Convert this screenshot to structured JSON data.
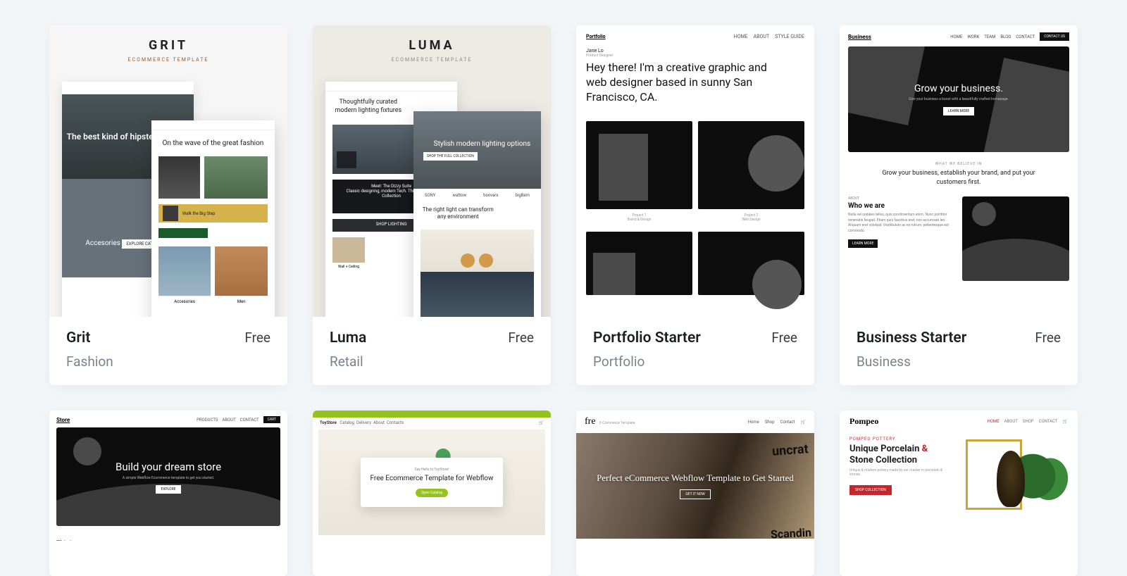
{
  "templates": [
    {
      "name": "Grit",
      "price": "Free",
      "category": "Fashion"
    },
    {
      "name": "Luma",
      "price": "Free",
      "category": "Retail"
    },
    {
      "name": "Portfolio Starter",
      "price": "Free",
      "category": "Portfolio"
    },
    {
      "name": "Business Starter",
      "price": "Free",
      "category": "Business"
    }
  ],
  "grit": {
    "title": "GRIT",
    "subtitle": "ECOMMERCE TEMPLATE",
    "hero": "The best kind of hipster clothing",
    "wave": "On the wave of the great fashion",
    "strip": "Walk the Big Step",
    "acc_title": "Accesories",
    "card_a": "Accesories",
    "card_b": "Men"
  },
  "luma": {
    "title": "LUMA",
    "subtitle": "ECOMMERCE TEMPLATE",
    "txt": "Thoughtfully curated modern lighting fixtures",
    "hero": "Stylish modern lighting options",
    "herobtn": "SHOP THE FULL COLLECTION",
    "cats": [
      "SONY",
      "wattow",
      "bonvars",
      "bigBem"
    ],
    "txt2": "The right light can transform any environment",
    "small": "Wall + Ceiling"
  },
  "portfolio": {
    "brand": "Portfolio",
    "nav": [
      "HOME",
      "ABOUT",
      "STYLE GUIDE"
    ],
    "name": "Jane Lo",
    "role": "Product Designer",
    "headline": "Hey there! I'm a creative graphic and web designer based in sunny San Francisco, CA.",
    "p1": "Project 1",
    "p1s": "Brand & Design",
    "p2": "Project 2",
    "p2s": "Web Design"
  },
  "business": {
    "brand": "Business",
    "nav": [
      "HOME",
      "WORK",
      "TEAM",
      "BLOG",
      "CONTACT"
    ],
    "cta": "CONTACT US",
    "hero": "Grow your business.",
    "herosub": "Give your business a boost with a beautifully crafted homepage.",
    "herobtn": "LEARN MORE",
    "midlbl": "WHAT WE BELIEVE IN",
    "midtxt": "Grow your business, establish your brand, and put your customers first.",
    "aboutlbl": "ABOUT",
    "about": "Who we are",
    "aboutp": "Nulla vel sodales tellus, quis condimentum enim. Nunc porttitor venenatis feugiat. Etiam quis faucibus erat, non accumsan leo. Aliquam erat volutpat. Vestibulum ac ex rutrum, pellentesque est commodo.",
    "aboutbtn": "LEARN MORE"
  },
  "row2": {
    "store": {
      "brand": "Store",
      "nav": [
        "PRODUCTS",
        "ABOUT",
        "CONTACT"
      ],
      "cart": "CART",
      "hero": "Build your dream store",
      "herosub": "A simple Webflow Ecommerce template to get you started.",
      "herobtn": "EXPLORE",
      "head": "This is your space"
    },
    "toystore": {
      "brand": "ToyStore",
      "nav": [
        "Catalog",
        "Delivery",
        "About",
        "Contacts"
      ],
      "cardlbl": "Say Hello to ToyStore!",
      "cardtitle": "Free Ecommerce Template for Webflow",
      "cardbtn": "Open Catalog"
    },
    "fre": {
      "brand": "fre",
      "sub": "E-Commerce Template",
      "nav": [
        "Home",
        "Shop",
        "Contact"
      ],
      "hero": "Perfect eCommerce Webflow Template to Get Started",
      "herobtn": "GET IT NOW"
    },
    "pompeo": {
      "brand": "Pompeo",
      "nav": [
        "HOME",
        "ABOUT",
        "SHOP",
        "CONTACT"
      ],
      "lbl": "POMPEO POTTERY",
      "h1": "Unique Porcelain",
      "amp": "&",
      "h2": "Stone Collection",
      "p": "Unique & modern pottery made by our master in porcelain & stones.",
      "btn": "SHOP COLLECTION"
    }
  }
}
